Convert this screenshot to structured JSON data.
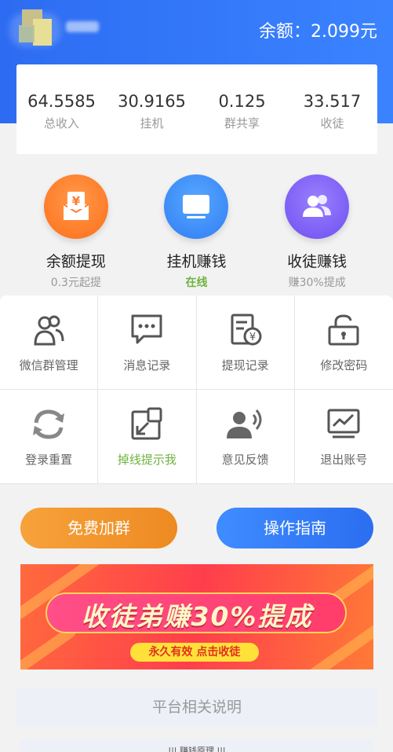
{
  "header": {
    "balance_text": "余额：2.099元"
  },
  "stats": [
    {
      "value": "64.5585",
      "label": "总收入"
    },
    {
      "value": "30.9165",
      "label": "挂机"
    },
    {
      "value": "0.125",
      "label": "群共享"
    },
    {
      "value": "33.517",
      "label": "收徒"
    }
  ],
  "features": [
    {
      "title": "余额提现",
      "subtitle": "0.3元起提",
      "icon": "wallet-yuan-icon",
      "color": "#ff7a2a"
    },
    {
      "title": "挂机赚钱",
      "subtitle": "在线",
      "icon": "monitor-icon",
      "color": "#3a8bff",
      "subtitle_color": "#6db33f"
    },
    {
      "title": "收徒赚钱",
      "subtitle": "赚30%提成",
      "icon": "users-icon",
      "color": "#7a5cff"
    }
  ],
  "menu": [
    {
      "label": "微信群管理",
      "icon": "group-icon"
    },
    {
      "label": "消息记录",
      "icon": "message-icon"
    },
    {
      "label": "提现记录",
      "icon": "receipt-icon"
    },
    {
      "label": "修改密码",
      "icon": "lock-icon"
    },
    {
      "label": "登录重置",
      "icon": "refresh-icon"
    },
    {
      "label": "掉线提示我",
      "icon": "external-icon",
      "color": "#6db33f"
    },
    {
      "label": "意见反馈",
      "icon": "speaker-icon"
    },
    {
      "label": "退出账号",
      "icon": "chart-monitor-icon"
    }
  ],
  "buttons": {
    "free_group": "免费加群",
    "guide": "操作指南"
  },
  "banner": {
    "headline": "收徒弟赚30%提成",
    "sub": "永久有效 点击收徒"
  },
  "platform_label": "平台相关说明",
  "principle_label": "||| 赚钱原理 |||"
}
